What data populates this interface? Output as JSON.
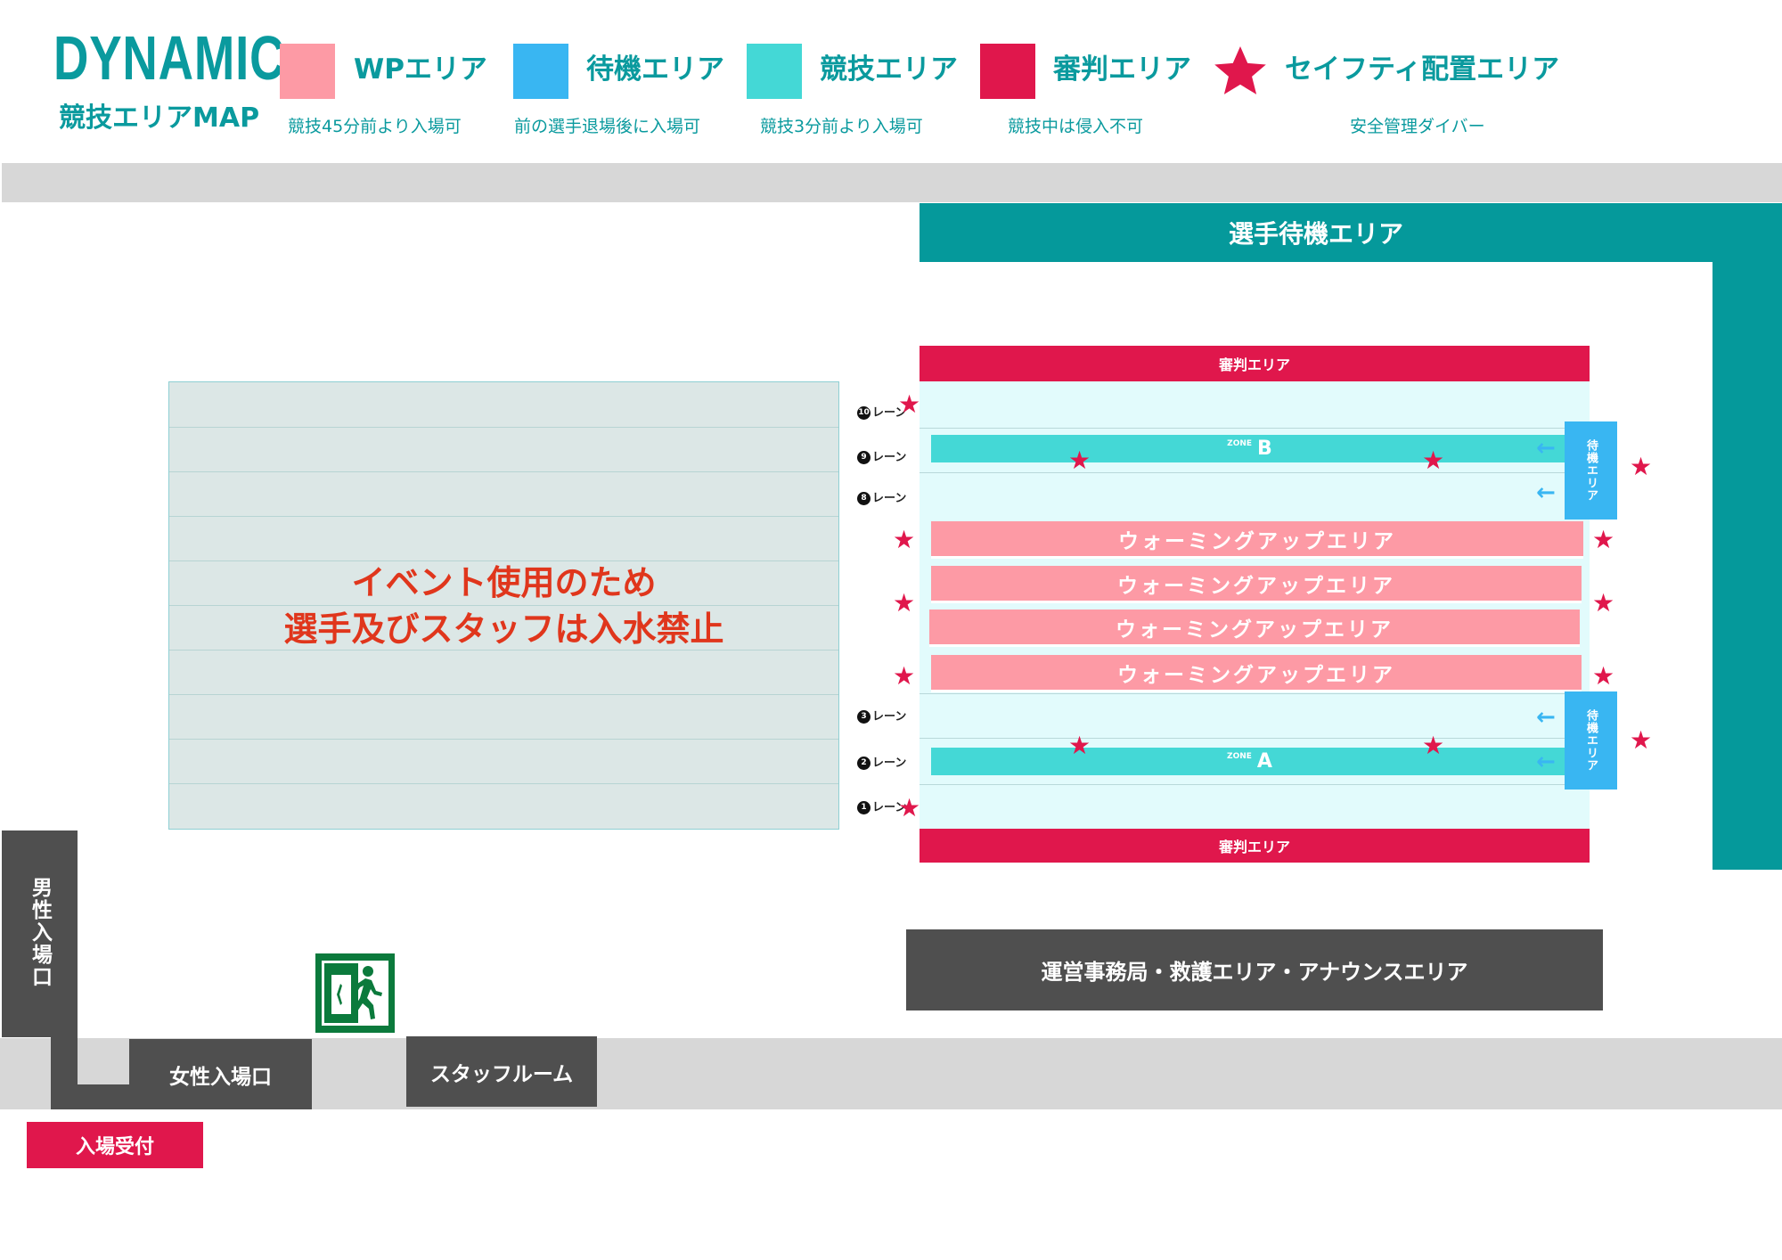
{
  "header": {
    "logo_title": "DYNAMIC",
    "logo_subtitle": "競技エリアMAP"
  },
  "legend": [
    {
      "label": "WPエリア",
      "desc": "競技45分前より入場可",
      "color": "#fd9aa5",
      "icon": "square"
    },
    {
      "label": "待機エリア",
      "desc": "前の選手退場後に入場可",
      "color": "#39b6f2",
      "icon": "square"
    },
    {
      "label": "競技エリア",
      "desc": "競技3分前より入場可",
      "color": "#44d8d6",
      "icon": "square"
    },
    {
      "label": "審判エリア",
      "desc": "競技中は侵入不可",
      "color": "#e0174c",
      "icon": "square"
    },
    {
      "label": "セイフティ配置エリア",
      "desc": "安全管理ダイバー",
      "color": "#e0174c",
      "icon": "star-icon"
    }
  ],
  "areas": {
    "athlete_waiting": "選手待機エリア",
    "event_notice_line1": "イベント使用のため",
    "event_notice_line2": "選手及びスタッフは入水禁止",
    "judge_top": "審判エリア",
    "judge_bottom": "審判エリア",
    "warmup": [
      "ウォーミングアップエリア",
      "ウォーミングアップエリア",
      "ウォーミングアップエリア",
      "ウォーミングアップエリア"
    ],
    "zone_word": "ZONE",
    "zone_b": "B",
    "zone_a": "A",
    "waiting_small": "待機エリア",
    "operations": "運営事務局・救護エリア・アナウンスエリア",
    "male_entrance": "男性入場口",
    "female_entrance": "女性入場口",
    "staff_room": "スタッフルーム",
    "reception": "入場受付"
  },
  "lanes": [
    {
      "num": "10",
      "label": "レーン"
    },
    {
      "num": "9",
      "label": "レーン"
    },
    {
      "num": "8",
      "label": "レーン"
    },
    {
      "num": "3",
      "label": "レーン"
    },
    {
      "num": "2",
      "label": "レーン"
    },
    {
      "num": "1",
      "label": "レーン"
    }
  ],
  "colors": {
    "teal": "#05999b",
    "wp": "#fd9aa5",
    "waiting": "#39b6f2",
    "competition": "#44d8d6",
    "judge": "#e0174c",
    "notice_text": "#e0361c",
    "exit_green": "#0b7a3c"
  }
}
